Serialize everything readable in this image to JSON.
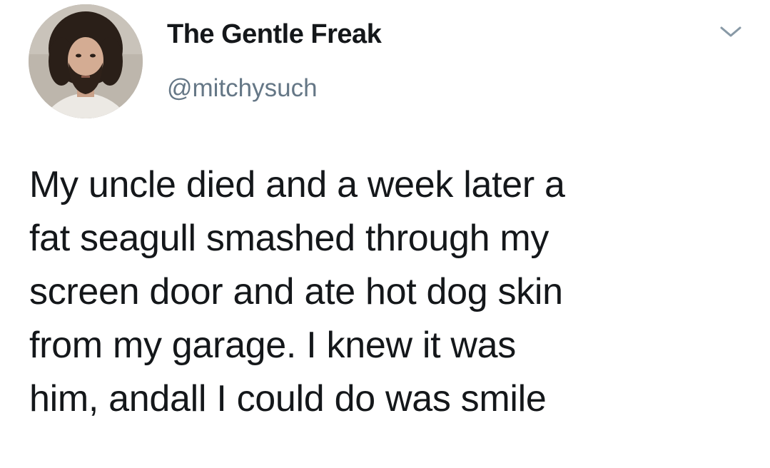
{
  "tweet": {
    "author": {
      "display_name": "The Gentle Freak",
      "handle": "@mitchysuch",
      "avatar_icon": "profile-photo"
    },
    "menu_icon": "chevron-down-icon",
    "text": "My uncle died and a week later a\nfat seagull smashed through my\nscreen door and ate hot dog skin\nfrom my garage. I  knew it was\nhim, andall I could do was smile"
  },
  "colors": {
    "text_primary": "#14171a",
    "text_secondary": "#657786",
    "chevron": "#8899a6",
    "background": "#ffffff"
  }
}
